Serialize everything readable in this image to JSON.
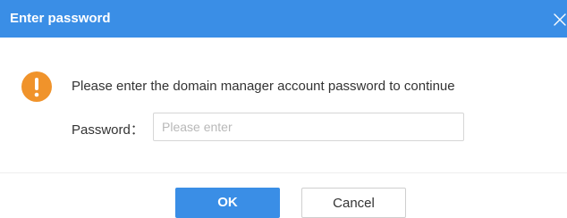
{
  "dialog": {
    "title": "Enter password",
    "message": "Please enter the domain manager account password to continue",
    "password_label": "Password：",
    "password_value": "",
    "password_placeholder": "Please enter",
    "ok_label": "OK",
    "cancel_label": "Cancel"
  },
  "icons": {
    "close": "close-icon",
    "warning": "warning-icon"
  },
  "colors": {
    "accent": "#3a8ee6",
    "warning": "#f0932b",
    "text": "#333333",
    "placeholder": "#b8b8b8"
  }
}
